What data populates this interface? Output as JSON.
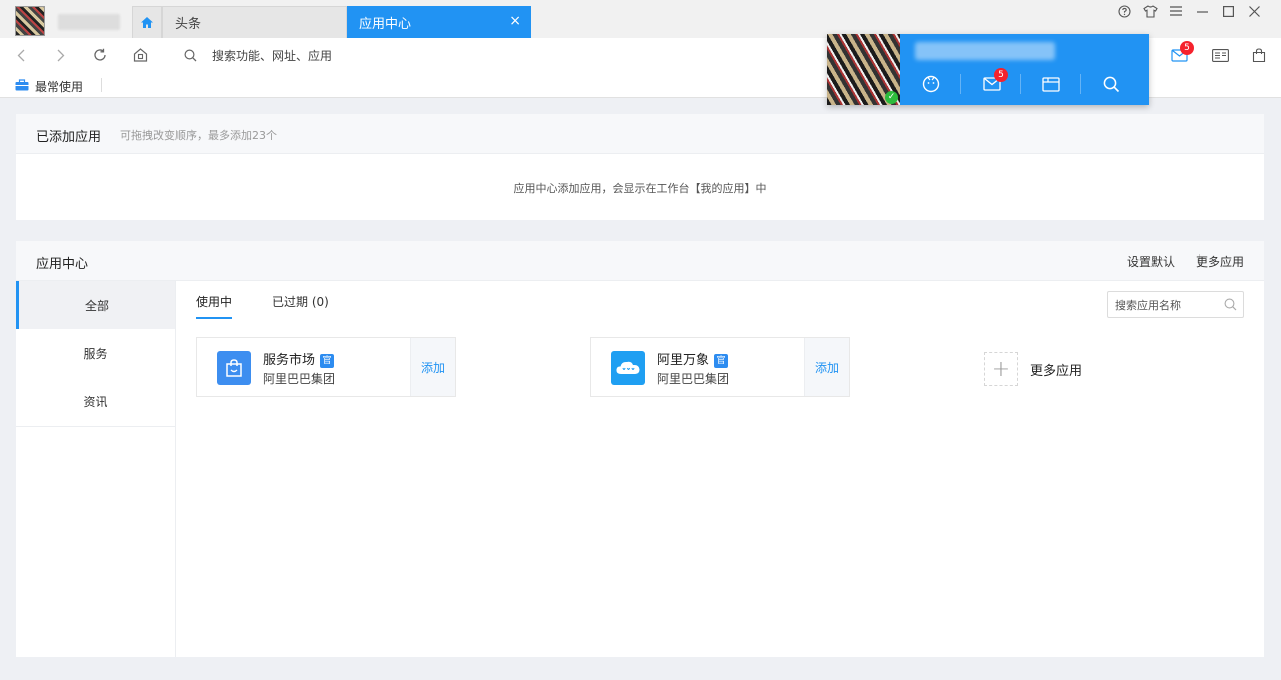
{
  "window": {
    "tabs": [
      {
        "label": "头条"
      },
      {
        "label": "应用中心"
      }
    ],
    "close_tab_glyph": "×",
    "controls": [
      "help-icon",
      "skin-icon",
      "menu-icon",
      "minimize-icon",
      "maximize-icon",
      "close-icon"
    ]
  },
  "navbar": {
    "search_placeholder": "搜索功能、网址、应用",
    "mail_badge": "5"
  },
  "bookmarks": {
    "label": "最常使用"
  },
  "popup": {
    "mail_badge": "5",
    "check_glyph": "✓"
  },
  "added_apps": {
    "title": "已添加应用",
    "hint": "可拖拽改变顺序，最多添加23个",
    "empty_message": "应用中心添加应用，会显示在工作台【我的应用】中"
  },
  "app_center": {
    "title": "应用中心",
    "links": {
      "set_default": "设置默认",
      "more_apps": "更多应用"
    },
    "sidebar": [
      {
        "label": "全部",
        "active": true
      },
      {
        "label": "服务",
        "active": false
      },
      {
        "label": "资讯",
        "active": false
      }
    ],
    "subtabs": [
      {
        "label": "使用中",
        "active": true
      },
      {
        "label": "已过期 (0)",
        "active": false
      }
    ],
    "search_placeholder": "搜索应用名称",
    "apps": [
      {
        "name": "服务市场",
        "official_badge": "官",
        "org": "阿里巴巴集团",
        "action": "添加",
        "icon": "shopping-bag-icon",
        "color": "#3d8ef0"
      },
      {
        "name": "阿里万象",
        "official_badge": "官",
        "org": "阿里巴巴集团",
        "action": "添加",
        "icon": "cloud-chat-icon",
        "color": "#1f9ff2"
      }
    ],
    "more_apps_label": "更多应用",
    "more_apps_glyph": "+"
  },
  "colors": {
    "accent": "#2193f3",
    "badge": "#f5222d"
  }
}
